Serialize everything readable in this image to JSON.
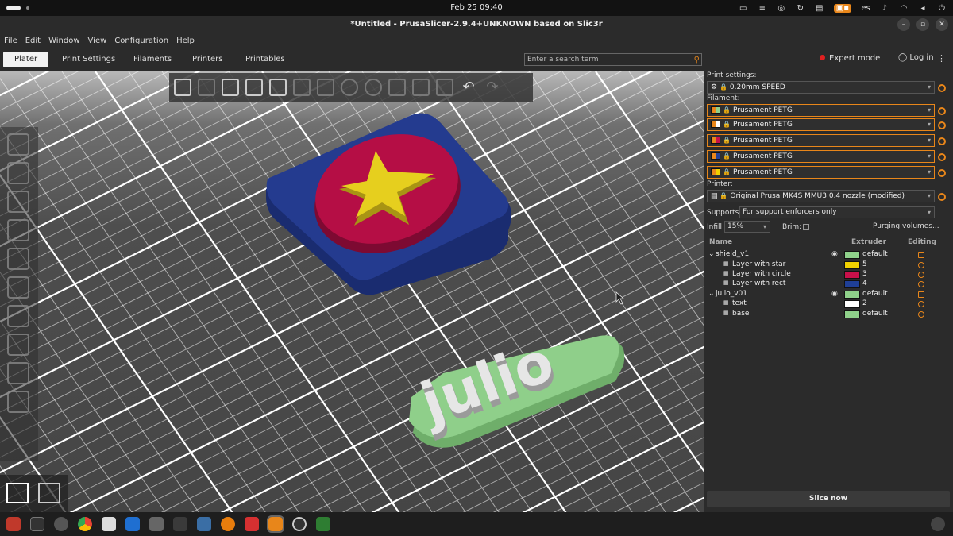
{
  "system_bar": {
    "clock": "Feb 25  09:40",
    "language": "es"
  },
  "window": {
    "title": "*Untitled - PrusaSlicer-2.9.4+UNKNOWN based on Slic3r"
  },
  "menu": [
    "File",
    "Edit",
    "Window",
    "View",
    "Configuration",
    "Help"
  ],
  "tabs": [
    {
      "label": "Plater",
      "active": true
    },
    {
      "label": "Print Settings",
      "active": false
    },
    {
      "label": "Filaments",
      "active": false
    },
    {
      "label": "Printers",
      "active": false
    },
    {
      "label": "Printables",
      "active": false
    }
  ],
  "search": {
    "placeholder": "Enter a search term"
  },
  "mode": {
    "label": "Expert mode",
    "color": "#e02020"
  },
  "login": {
    "label": "Log in"
  },
  "viewport": {
    "model_text": "julio",
    "colors": {
      "bed": "#4b4b4b",
      "grid": "#ffffff",
      "shield_rect": "#233a8c",
      "shield_circle": "#b50e45",
      "shield_star": "#e6cf1e",
      "text_letters": "#e6e6e6",
      "text_base": "#8fcf8a"
    }
  },
  "sidebar": {
    "print_settings_label": "Print settings:",
    "print_profile": "0.20mm SPEED",
    "filament_label": "Filament:",
    "filaments": [
      {
        "name": "Prusament PETG",
        "color": "#e8861a"
      },
      {
        "name": "Prusament PETG",
        "color": "#e8861a"
      },
      {
        "name": "Prusament PETG",
        "color": "#e8861a"
      },
      {
        "name": "Prusament PETG",
        "color": "#e8861a"
      },
      {
        "name": "Prusament PETG",
        "color": "#e8861a"
      }
    ],
    "printer_label": "Printer:",
    "printer": "Original Prusa MK4S MMU3 0.4 nozzle (modified)",
    "supports_label": "Supports:",
    "supports_value": "For support enforcers only",
    "infill_label": "Infill:",
    "infill_value": "15%",
    "brim_label": "Brim:",
    "purging_label": "Purging volumes...",
    "columns": {
      "name": "Name",
      "extruder": "Extruder",
      "editing": "Editing"
    },
    "objects": [
      {
        "name": "shield_v1",
        "level": 0,
        "extruder": "default",
        "color": "#8fd18a",
        "eye": true
      },
      {
        "name": "Layer with star",
        "level": 1,
        "extruder": "5",
        "color": "#f0d000"
      },
      {
        "name": "Layer with circle",
        "level": 1,
        "extruder": "3",
        "color": "#c8104a"
      },
      {
        "name": "Layer with rect",
        "level": 1,
        "extruder": "4",
        "color": "#1f3f96"
      },
      {
        "name": "julio_v01",
        "level": 0,
        "extruder": "default",
        "color": "#8fd18a",
        "eye": true
      },
      {
        "name": "text",
        "level": 1,
        "extruder": "2",
        "color": "#ffffff"
      },
      {
        "name": "base",
        "level": 1,
        "extruder": "default",
        "color": "#8fd18a"
      }
    ],
    "slice_button": "Slice now"
  }
}
